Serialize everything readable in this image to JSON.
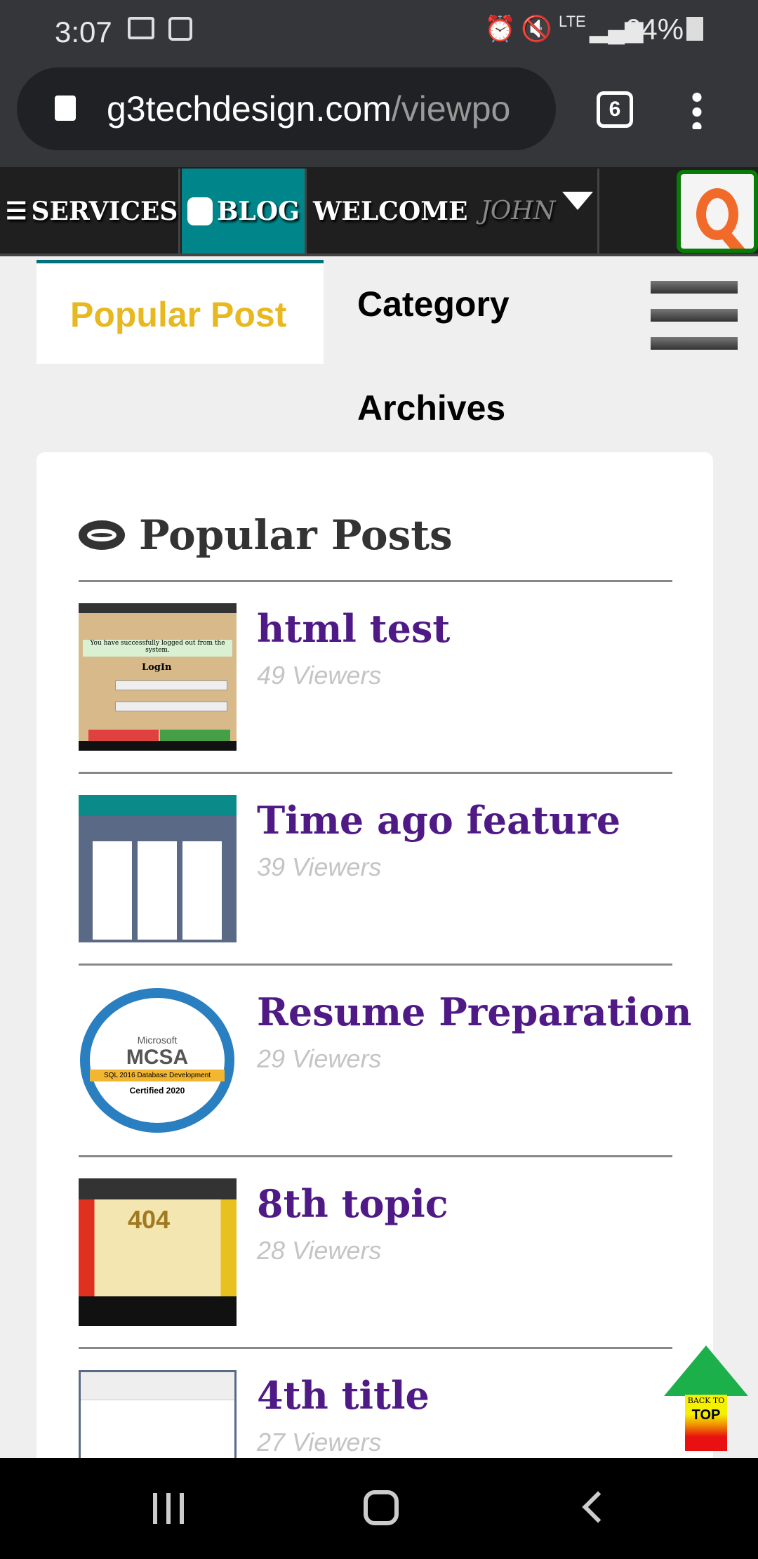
{
  "status": {
    "time": "3:07",
    "battery": "64%",
    "network": "LTE"
  },
  "browser": {
    "url_domain": "g3techdesign.com",
    "url_path": "/viewpo",
    "tab_count": "6"
  },
  "nav": {
    "services": "SERVICES",
    "blog": "BLOG",
    "welcome": "WELCOME",
    "user": "JOHN",
    "blog_color": "#00868a"
  },
  "tabs": {
    "popular": "Popular Post",
    "category": "Category",
    "archives": "Archives",
    "active_color": "#e8b820"
  },
  "section": {
    "title": "Popular Posts"
  },
  "posts": [
    {
      "title": "html test",
      "views": "49 Viewers"
    },
    {
      "title": "Time ago feature",
      "views": "39 Viewers"
    },
    {
      "title": "Resume Preparation",
      "views": "29 Viewers"
    },
    {
      "title": "8th topic",
      "views": "28 Viewers"
    },
    {
      "title": "4th title",
      "views": "27 Viewers"
    }
  ],
  "thumbs": {
    "login_out": "You have successfully logged out from the system.",
    "login": "LogIn",
    "mcsa_brand": "Microsoft",
    "mcsa": "MCSA",
    "mcsa_sub": "SQL 2016 Database Development",
    "mcsa_ring": "Certified 2020",
    "err404": "404"
  },
  "back_to_top": {
    "line1": "BACK TO",
    "line2": "TOP"
  }
}
